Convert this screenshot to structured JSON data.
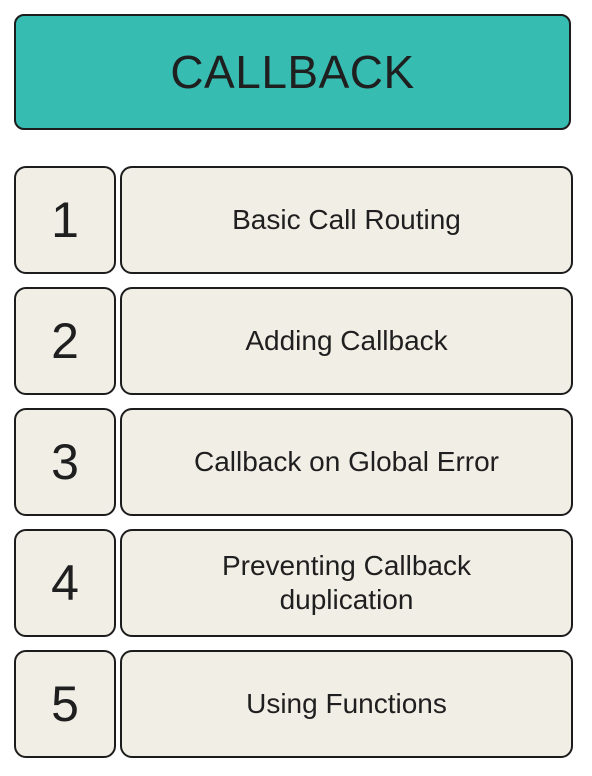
{
  "title": "CALLBACK",
  "steps": [
    {
      "number": "1",
      "label": "Basic Call Routing"
    },
    {
      "number": "2",
      "label": "Adding Callback"
    },
    {
      "number": "3",
      "label": "Callback on Global Error"
    },
    {
      "number": "4",
      "label": "Preventing Callback duplication"
    },
    {
      "number": "5",
      "label": "Using Functions"
    }
  ],
  "colors": {
    "header": "#37bcb2",
    "box": "#f1eee6",
    "border": "#1c1c1c"
  }
}
